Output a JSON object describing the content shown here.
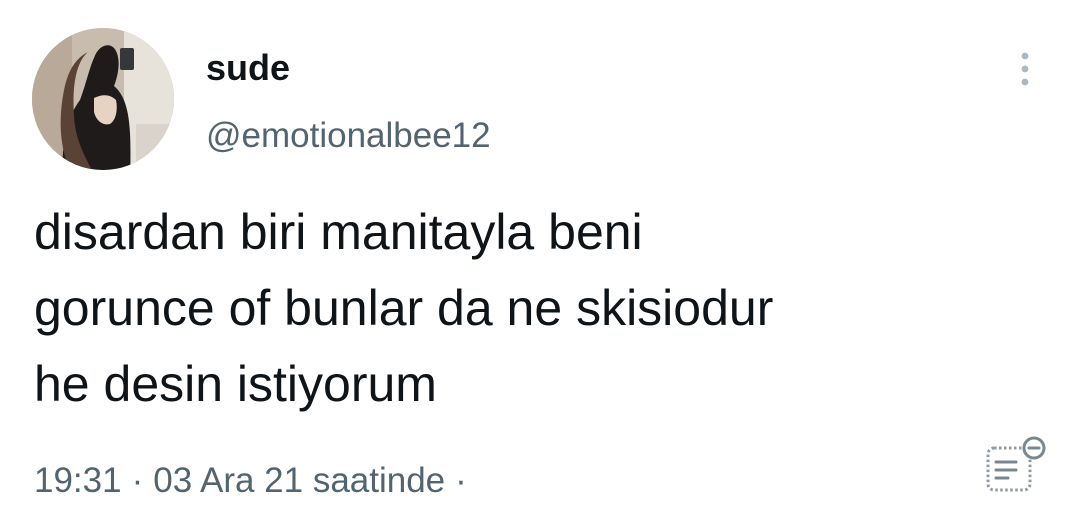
{
  "user": {
    "display_name": "sude",
    "handle": "@emotionalbee12",
    "avatar_icon": "profile-photo"
  },
  "tweet": {
    "text_lines": [
      "disardan biri manitayla beni",
      "gorunce of bunlar da ne skisiodur",
      "he desin istiyorum"
    ]
  },
  "meta": {
    "time": "19:31",
    "separator": "·",
    "date": "03 Ara 21 saatinde",
    "trailing_separator": "·"
  },
  "icons": {
    "more": "more-vertical-icon",
    "notes": "notes-icon"
  },
  "colors": {
    "primary_text": "#0f1419",
    "secondary_text": "#536471",
    "icon_gray": "#aab8c2"
  }
}
